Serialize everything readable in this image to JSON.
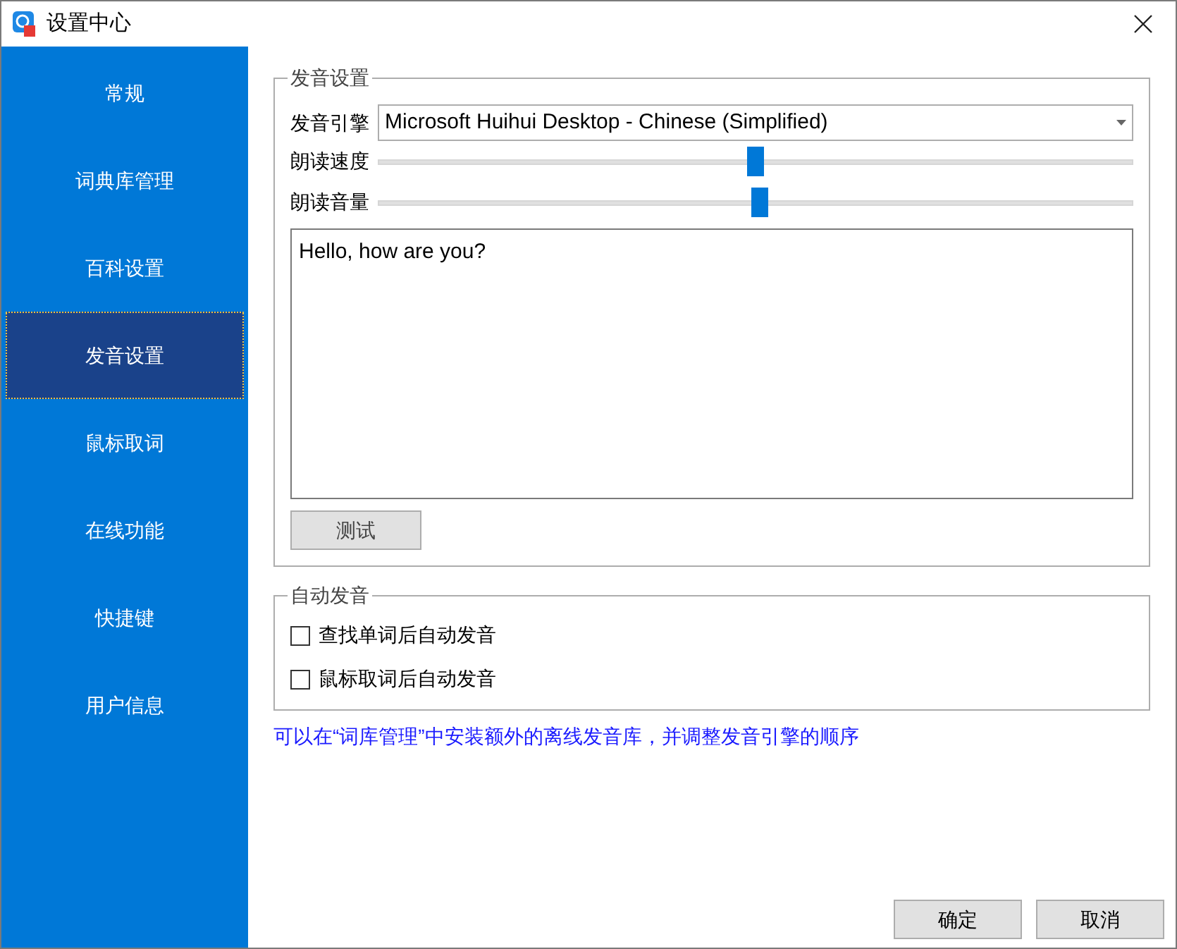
{
  "window": {
    "title": "设置中心"
  },
  "sidebar": {
    "items": [
      {
        "label": "常规",
        "selected": false
      },
      {
        "label": "词典库管理",
        "selected": false
      },
      {
        "label": "百科设置",
        "selected": false
      },
      {
        "label": "发音设置",
        "selected": true
      },
      {
        "label": "鼠标取词",
        "selected": false
      },
      {
        "label": "在线功能",
        "selected": false
      },
      {
        "label": "快捷键",
        "selected": false
      },
      {
        "label": "用户信息",
        "selected": false
      }
    ]
  },
  "pronunciation": {
    "title": "发音设置",
    "engine_label": "发音引擎",
    "engine_value": "Microsoft Huihui Desktop - Chinese (Simplified)",
    "sliders": [
      {
        "label": "朗读速度",
        "level": 0.5
      },
      {
        "label": "朗读音量",
        "level": 0.505
      }
    ],
    "test_text": "Hello, how are you?",
    "test_button": "测试"
  },
  "auto": {
    "title": "自动发音",
    "options": [
      {
        "label": "查找单词后自动发音",
        "checked": false
      },
      {
        "label": "鼠标取词后自动发音",
        "checked": false
      }
    ]
  },
  "note": "可以在“词库管理”中安装额外的离线发音库，并调整发音引擎的顺序",
  "buttons": [
    "确定",
    "取消"
  ]
}
